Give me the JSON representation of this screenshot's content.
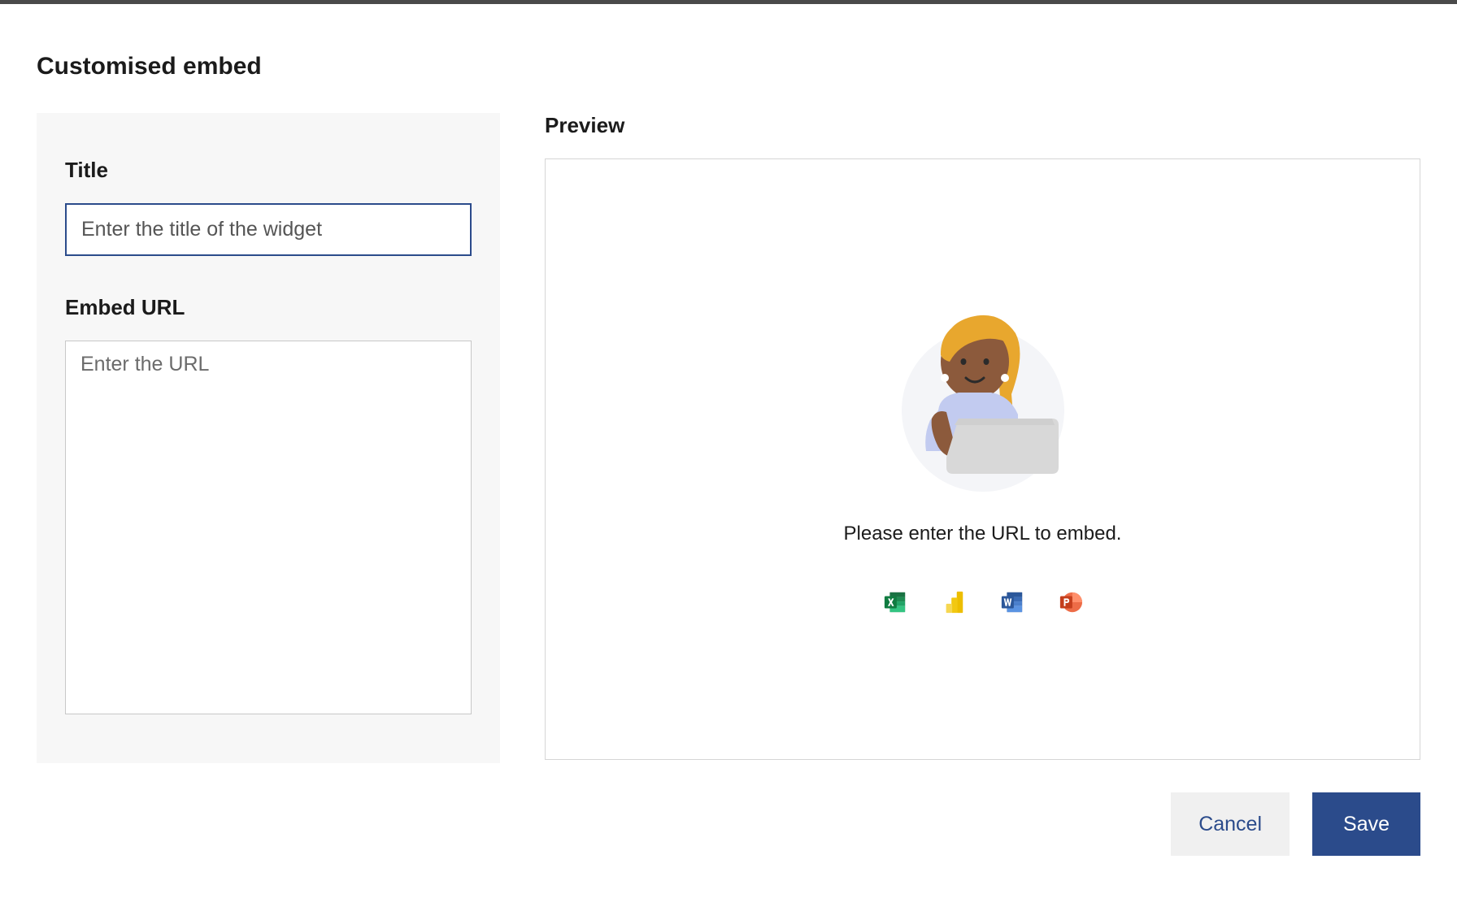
{
  "dialog": {
    "title": "Customised embed"
  },
  "form": {
    "title_label": "Title",
    "title_placeholder": "Enter the title of the widget",
    "title_value": "",
    "url_label": "Embed URL",
    "url_placeholder": "Enter the URL",
    "url_value": ""
  },
  "preview": {
    "label": "Preview",
    "message": "Please enter the URL to embed.",
    "app_icons": [
      "excel",
      "powerbi",
      "word",
      "powerpoint"
    ]
  },
  "buttons": {
    "cancel": "Cancel",
    "save": "Save"
  }
}
